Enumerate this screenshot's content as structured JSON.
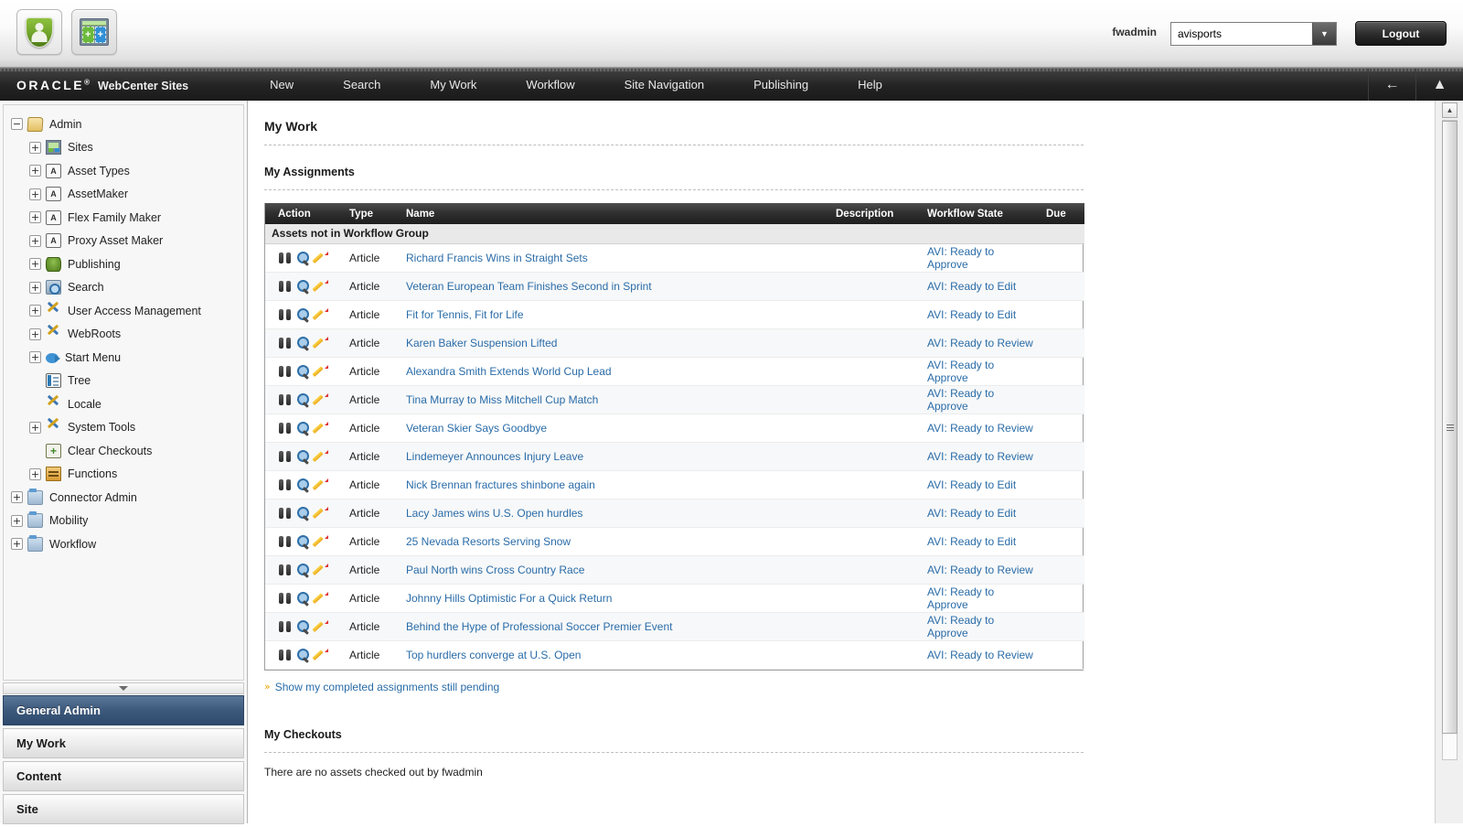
{
  "toolbar": {
    "admin_icon": "shield-person-icon",
    "sites_icon": "sites-icon",
    "user": "fwadmin",
    "site_selected": "avisports",
    "logout_label": "Logout"
  },
  "nav": {
    "brand_oracle": "ORACLE",
    "brand_reg": "®",
    "brand_product": "WebCenter Sites",
    "items": [
      {
        "label": "New"
      },
      {
        "label": "Search"
      },
      {
        "label": "My Work"
      },
      {
        "label": "Workflow"
      },
      {
        "label": "Site Navigation"
      },
      {
        "label": "Publishing"
      },
      {
        "label": "Help"
      }
    ],
    "back_icon": "left-arrow-icon",
    "eject_icon": "eject-icon"
  },
  "sidebar": {
    "tree": [
      {
        "label": "Admin",
        "toggle": "−",
        "icon": "folder-open-icon",
        "depth": 0
      },
      {
        "label": "Sites",
        "toggle": "+",
        "icon": "sites-icon",
        "depth": 1
      },
      {
        "label": "Asset Types",
        "toggle": "+",
        "icon": "asset-type-icon",
        "depth": 1
      },
      {
        "label": "AssetMaker",
        "toggle": "+",
        "icon": "asset-type-icon",
        "depth": 1
      },
      {
        "label": "Flex Family Maker",
        "toggle": "+",
        "icon": "asset-type-icon",
        "depth": 1
      },
      {
        "label": "Proxy Asset Maker",
        "toggle": "+",
        "icon": "asset-type-icon",
        "depth": 1
      },
      {
        "label": "Publishing",
        "toggle": "+",
        "icon": "publishing-icon",
        "depth": 1
      },
      {
        "label": "Search",
        "toggle": "+",
        "icon": "search-icon",
        "depth": 1
      },
      {
        "label": "User Access Management",
        "toggle": "+",
        "icon": "tools-icon",
        "depth": 1
      },
      {
        "label": "WebRoots",
        "toggle": "+",
        "icon": "tools-icon",
        "depth": 1
      },
      {
        "label": "Start Menu",
        "toggle": "+",
        "icon": "start-menu-icon",
        "depth": 1
      },
      {
        "label": "Tree",
        "toggle": "",
        "icon": "tree-icon",
        "depth": 1
      },
      {
        "label": "Locale",
        "toggle": "",
        "icon": "tools-icon",
        "depth": 1
      },
      {
        "label": "System Tools",
        "toggle": "+",
        "icon": "tools-icon",
        "depth": 1
      },
      {
        "label": "Clear Checkouts",
        "toggle": "",
        "icon": "clear-checkouts-icon",
        "depth": 1
      },
      {
        "label": "Functions",
        "toggle": "+",
        "icon": "functions-icon",
        "depth": 1
      },
      {
        "label": "Connector Admin",
        "toggle": "+",
        "icon": "folder-icon",
        "depth": 0
      },
      {
        "label": "Mobility",
        "toggle": "+",
        "icon": "folder-icon",
        "depth": 0
      },
      {
        "label": "Workflow",
        "toggle": "+",
        "icon": "folder-icon",
        "depth": 0
      }
    ],
    "collapse_icon": "chevron-down-icon",
    "panels": [
      {
        "label": "General Admin",
        "active": true
      },
      {
        "label": "My Work",
        "active": false
      },
      {
        "label": "Content",
        "active": false
      },
      {
        "label": "Site",
        "active": false
      }
    ]
  },
  "main": {
    "page_title": "My Work",
    "assignments_title": "My Assignments",
    "columns": [
      "Action",
      "Type",
      "Name",
      "Description",
      "Workflow State",
      "Due"
    ],
    "group_label": "Assets not in Workflow Group",
    "action_icons": [
      "binoculars-icon",
      "magnifier-icon",
      "pencil-icon"
    ],
    "rows": [
      {
        "type": "Article",
        "name": "Richard Francis Wins in Straight Sets",
        "description": "",
        "state": "AVI: Ready to Approve",
        "due": ""
      },
      {
        "type": "Article",
        "name": "Veteran European Team Finishes Second in Sprint",
        "description": "",
        "state": "AVI: Ready to Edit",
        "due": ""
      },
      {
        "type": "Article",
        "name": "Fit for Tennis, Fit for Life",
        "description": "",
        "state": "AVI: Ready to Edit",
        "due": ""
      },
      {
        "type": "Article",
        "name": "Karen Baker Suspension Lifted",
        "description": "",
        "state": "AVI: Ready to Review",
        "due": ""
      },
      {
        "type": "Article",
        "name": "Alexandra Smith Extends World Cup Lead",
        "description": "",
        "state": "AVI: Ready to Approve",
        "due": ""
      },
      {
        "type": "Article",
        "name": "Tina Murray to Miss Mitchell Cup Match",
        "description": "",
        "state": "AVI: Ready to Approve",
        "due": ""
      },
      {
        "type": "Article",
        "name": "Veteran Skier Says Goodbye",
        "description": "",
        "state": "AVI: Ready to Review",
        "due": ""
      },
      {
        "type": "Article",
        "name": "Lindemeyer Announces Injury Leave",
        "description": "",
        "state": "AVI: Ready to Review",
        "due": ""
      },
      {
        "type": "Article",
        "name": "Nick Brennan fractures shinbone again",
        "description": "",
        "state": "AVI: Ready to Edit",
        "due": ""
      },
      {
        "type": "Article",
        "name": "Lacy James wins U.S. Open hurdles",
        "description": "",
        "state": "AVI: Ready to Edit",
        "due": ""
      },
      {
        "type": "Article",
        "name": "25 Nevada Resorts Serving Snow",
        "description": "",
        "state": "AVI: Ready to Edit",
        "due": ""
      },
      {
        "type": "Article",
        "name": "Paul North wins Cross Country Race",
        "description": "",
        "state": "AVI: Ready to Review",
        "due": ""
      },
      {
        "type": "Article",
        "name": "Johnny Hills Optimistic For a Quick Return",
        "description": "",
        "state": "AVI: Ready to Approve",
        "due": ""
      },
      {
        "type": "Article",
        "name": "Behind the Hype of Professional Soccer Premier Event",
        "description": "",
        "state": "AVI: Ready to Approve",
        "due": ""
      },
      {
        "type": "Article",
        "name": "Top hurdlers converge at U.S. Open",
        "description": "",
        "state": "AVI: Ready to Review",
        "due": ""
      }
    ],
    "show_completed_label": "Show my completed assignments still pending",
    "show_completed_bullet": "»",
    "checkouts_title": "My Checkouts",
    "checkouts_empty": "There are no assets checked out by fwadmin"
  },
  "colors": {
    "link": "#2a6ca8",
    "panel_active": "#3c597c",
    "header_dark": "#2b2b2b"
  }
}
